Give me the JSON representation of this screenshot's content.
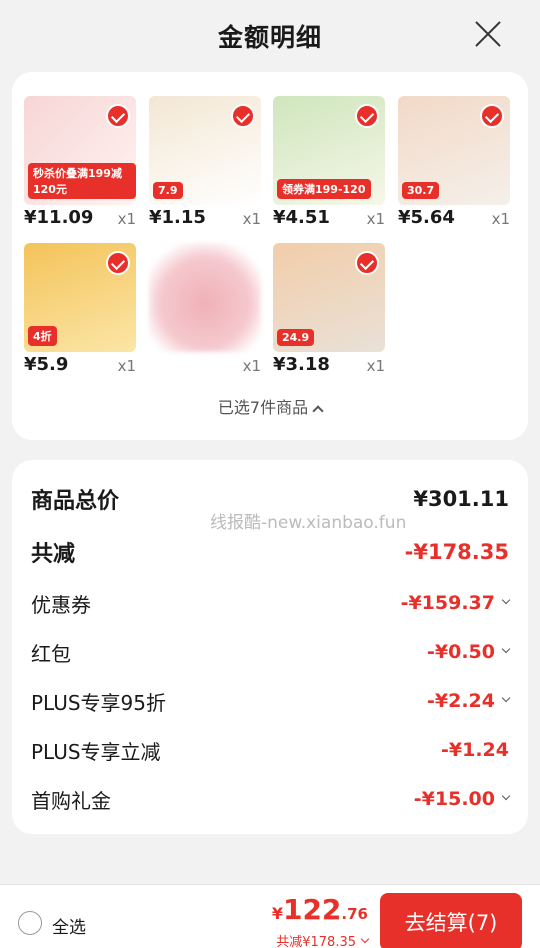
{
  "header": {
    "title": "金额明细"
  },
  "products": [
    {
      "price": "¥11.09",
      "qty": "x1",
      "thumb": "秒杀价叠满199减120元",
      "bg": "#f7d5d6",
      "bg2": "#fff3f0",
      "checked": true
    },
    {
      "price": "¥1.15",
      "qty": "x1",
      "thumb": "7.9",
      "bg": "#f3e7d3",
      "bg2": "#ffffff",
      "checked": true
    },
    {
      "price": "¥4.51",
      "qty": "x1",
      "thumb": "领券满199-120",
      "bg": "#cfe6bd",
      "bg2": "#f6f7e8",
      "checked": true
    },
    {
      "price": "¥5.64",
      "qty": "x1",
      "thumb": "30.7",
      "bg": "#f3d9c7",
      "bg2": "#f4f0ea",
      "checked": true
    },
    {
      "price": "¥5.9",
      "qty": "x1",
      "thumb": "4折",
      "bg": "#f4c35a",
      "bg2": "#fbe6a7",
      "checked": true
    },
    {
      "price": "",
      "qty": "x1",
      "thumb": "",
      "bg": "#f5c9cf",
      "bg2": "#efb1b6",
      "checked": false
    },
    {
      "price": "¥3.18",
      "qty": "x1",
      "thumb": "24.9",
      "bg": "#f2cda9",
      "bg2": "#e9e1d8",
      "checked": true
    }
  ],
  "selected_text": "已选7件商品",
  "summary": {
    "watermark": "线报酷-new.xianbao.fun",
    "rows": [
      {
        "label": "商品总价",
        "value": "¥301.11"
      },
      {
        "label": "共减",
        "value": "-¥178.35"
      },
      {
        "label": "优惠券",
        "value": "-¥159.37"
      },
      {
        "label": "红包",
        "value": "-¥0.50"
      },
      {
        "label": "PLUS专享95折",
        "value": "-¥2.24"
      },
      {
        "label": "PLUS专享立减",
        "value": "-¥1.24"
      },
      {
        "label": "首购礼金",
        "value": "-¥15.00"
      }
    ]
  },
  "bottom": {
    "select_all": "全选",
    "currency": "¥",
    "total_int": "122",
    "total_dec": ".76",
    "discount": "共减¥178.35",
    "checkout": "去结算(7)"
  },
  "colors": {
    "accent": "#e8302a"
  }
}
